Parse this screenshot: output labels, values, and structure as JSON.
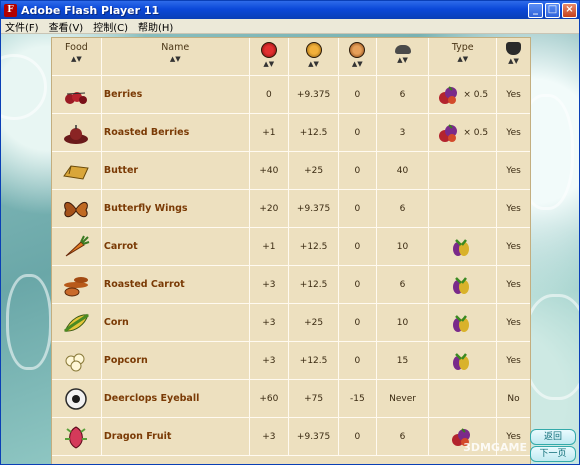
{
  "window": {
    "title": "Adobe Flash Player 11",
    "app_icon": "F"
  },
  "menu": [
    "文件(F)",
    "查看(V)",
    "控制(C)",
    "帮助(H)"
  ],
  "controls": {
    "minimize": "_",
    "maximize": "□",
    "close": "×"
  },
  "columns": {
    "food": "Food",
    "name": "Name",
    "health_icon": "heart-icon",
    "hunger_icon": "stomach-icon",
    "sanity_icon": "brain-icon",
    "spoil_icon": "spoil-icon",
    "type": "Type",
    "cook_icon": "crock-pot-icon",
    "sort_symbol": "▲▼"
  },
  "rows": [
    {
      "icon": "berries-icon",
      "name": "Berries",
      "health": "0",
      "hunger": "+9.375",
      "sanity": "0",
      "spoil": "6",
      "type": "fruit-icon",
      "type_mult": "× 0.5",
      "cookable": "Yes"
    },
    {
      "icon": "roasted-berries-icon",
      "name": "Roasted Berries",
      "health": "+1",
      "hunger": "+12.5",
      "sanity": "0",
      "spoil": "3",
      "type": "fruit-icon",
      "type_mult": "× 0.5",
      "cookable": "Yes"
    },
    {
      "icon": "butter-icon",
      "name": "Butter",
      "health": "+40",
      "hunger": "+25",
      "sanity": "0",
      "spoil": "40",
      "type": "",
      "type_mult": "",
      "cookable": "Yes"
    },
    {
      "icon": "butterfly-wings-icon",
      "name": "Butterfly Wings",
      "health": "+20",
      "hunger": "+9.375",
      "sanity": "0",
      "spoil": "6",
      "type": "",
      "type_mult": "",
      "cookable": "Yes"
    },
    {
      "icon": "carrot-icon",
      "name": "Carrot",
      "health": "+1",
      "hunger": "+12.5",
      "sanity": "0",
      "spoil": "10",
      "type": "vegetable-icon",
      "type_mult": "",
      "cookable": "Yes"
    },
    {
      "icon": "roasted-carrot-icon",
      "name": "Roasted Carrot",
      "health": "+3",
      "hunger": "+12.5",
      "sanity": "0",
      "spoil": "6",
      "type": "vegetable-icon",
      "type_mult": "",
      "cookable": "Yes"
    },
    {
      "icon": "corn-icon",
      "name": "Corn",
      "health": "+3",
      "hunger": "+25",
      "sanity": "0",
      "spoil": "10",
      "type": "vegetable-icon",
      "type_mult": "",
      "cookable": "Yes"
    },
    {
      "icon": "popcorn-icon",
      "name": "Popcorn",
      "health": "+3",
      "hunger": "+12.5",
      "sanity": "0",
      "spoil": "15",
      "type": "vegetable-icon",
      "type_mult": "",
      "cookable": "Yes"
    },
    {
      "icon": "deerclops-eyeball-icon",
      "name": "Deerclops Eyeball",
      "health": "+60",
      "hunger": "+75",
      "sanity": "-15",
      "spoil": "Never",
      "type": "",
      "type_mult": "",
      "cookable": "No"
    },
    {
      "icon": "dragon-fruit-icon",
      "name": "Dragon Fruit",
      "health": "+3",
      "hunger": "+9.375",
      "sanity": "0",
      "spoil": "6",
      "type": "fruit-icon",
      "type_mult": "",
      "cookable": "Yes"
    }
  ],
  "watermark": "3DMGAME",
  "side_buttons": [
    "返回",
    "下一页"
  ]
}
